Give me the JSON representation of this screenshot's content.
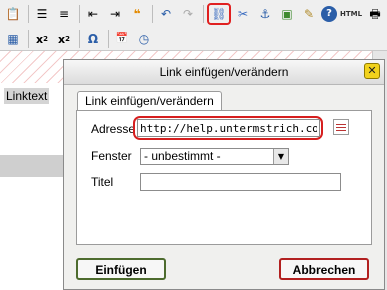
{
  "toolbar": {
    "row1": [
      "paste-icon",
      "bullet-list-icon",
      "numbered-list-icon",
      "outdent-icon",
      "indent-icon",
      "blockquote-icon",
      "undo-icon",
      "redo-icon",
      "link-icon",
      "unlink-icon",
      "anchor-icon",
      "image-icon",
      "cleanup-icon",
      "help-icon",
      "html-icon",
      "print-icon"
    ],
    "html_label": "HTML",
    "row2": [
      "table-icon",
      "subscript-icon",
      "superscript-icon",
      "special-char-icon",
      "insert-date-icon",
      "insert-time-icon"
    ],
    "colors": {
      "highlight": "#e02020"
    }
  },
  "editor": {
    "selected_text": "Linktext"
  },
  "dialog": {
    "title": "Link einfügen/verändern",
    "close_glyph": "✕",
    "tab_label": "Link einfügen/verändern",
    "fields": {
      "address_label": "Adresse",
      "address_value": "http://help.untermstrich.com",
      "window_label": "Fenster",
      "window_value": "- unbestimmt -",
      "title_label": "Titel",
      "title_value": ""
    },
    "buttons": {
      "insert": "Einfügen",
      "cancel": "Abbrechen"
    }
  }
}
